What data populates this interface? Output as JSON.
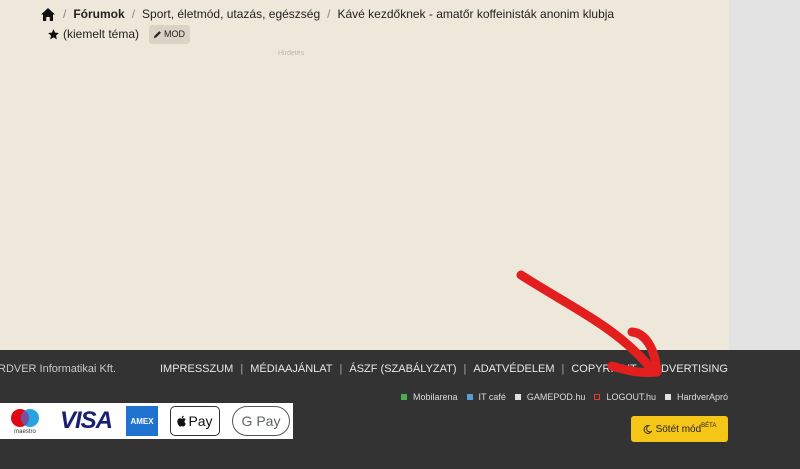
{
  "breadcrumb": {
    "home_icon": "home-icon",
    "items": [
      "Fórumok",
      "Sport, életmód, utazás, egészség",
      "Kávé kezdőknek - amatőr koffeinisták anonim klubja"
    ],
    "featured_label": "(kiemelt téma)",
    "mod_label": "MOD"
  },
  "ad": {
    "label": "Hirdetés"
  },
  "footer": {
    "company": "RDVER Informatikai Kft.",
    "links": [
      "IMPRESSZUM",
      "MÉDIAAJÁNLAT",
      "ÁSZF (SZABÁLYZAT)",
      "ADATVÉDELEM",
      "COPYRIGHT",
      "ADVERTISING"
    ],
    "sites": [
      {
        "label": "Mobilarena",
        "color": "#4caf50"
      },
      {
        "label": "IT café",
        "color": "#5b9bd5"
      },
      {
        "label": "GAMEPOD.hu",
        "color": "#e0e0e0"
      },
      {
        "label": "LOGOUT.hu",
        "color": "#e53935"
      },
      {
        "label": "HardverApró",
        "color": "#e0e0e0"
      }
    ],
    "payments": [
      "maestro",
      "VISA",
      "AMEX",
      "Pay",
      "G Pay"
    ],
    "dark_mode": {
      "label": "Sötét mód",
      "badge": "BÉTA",
      "color": "#f5c518"
    }
  },
  "annotation": {
    "color": "#e31e1e"
  }
}
